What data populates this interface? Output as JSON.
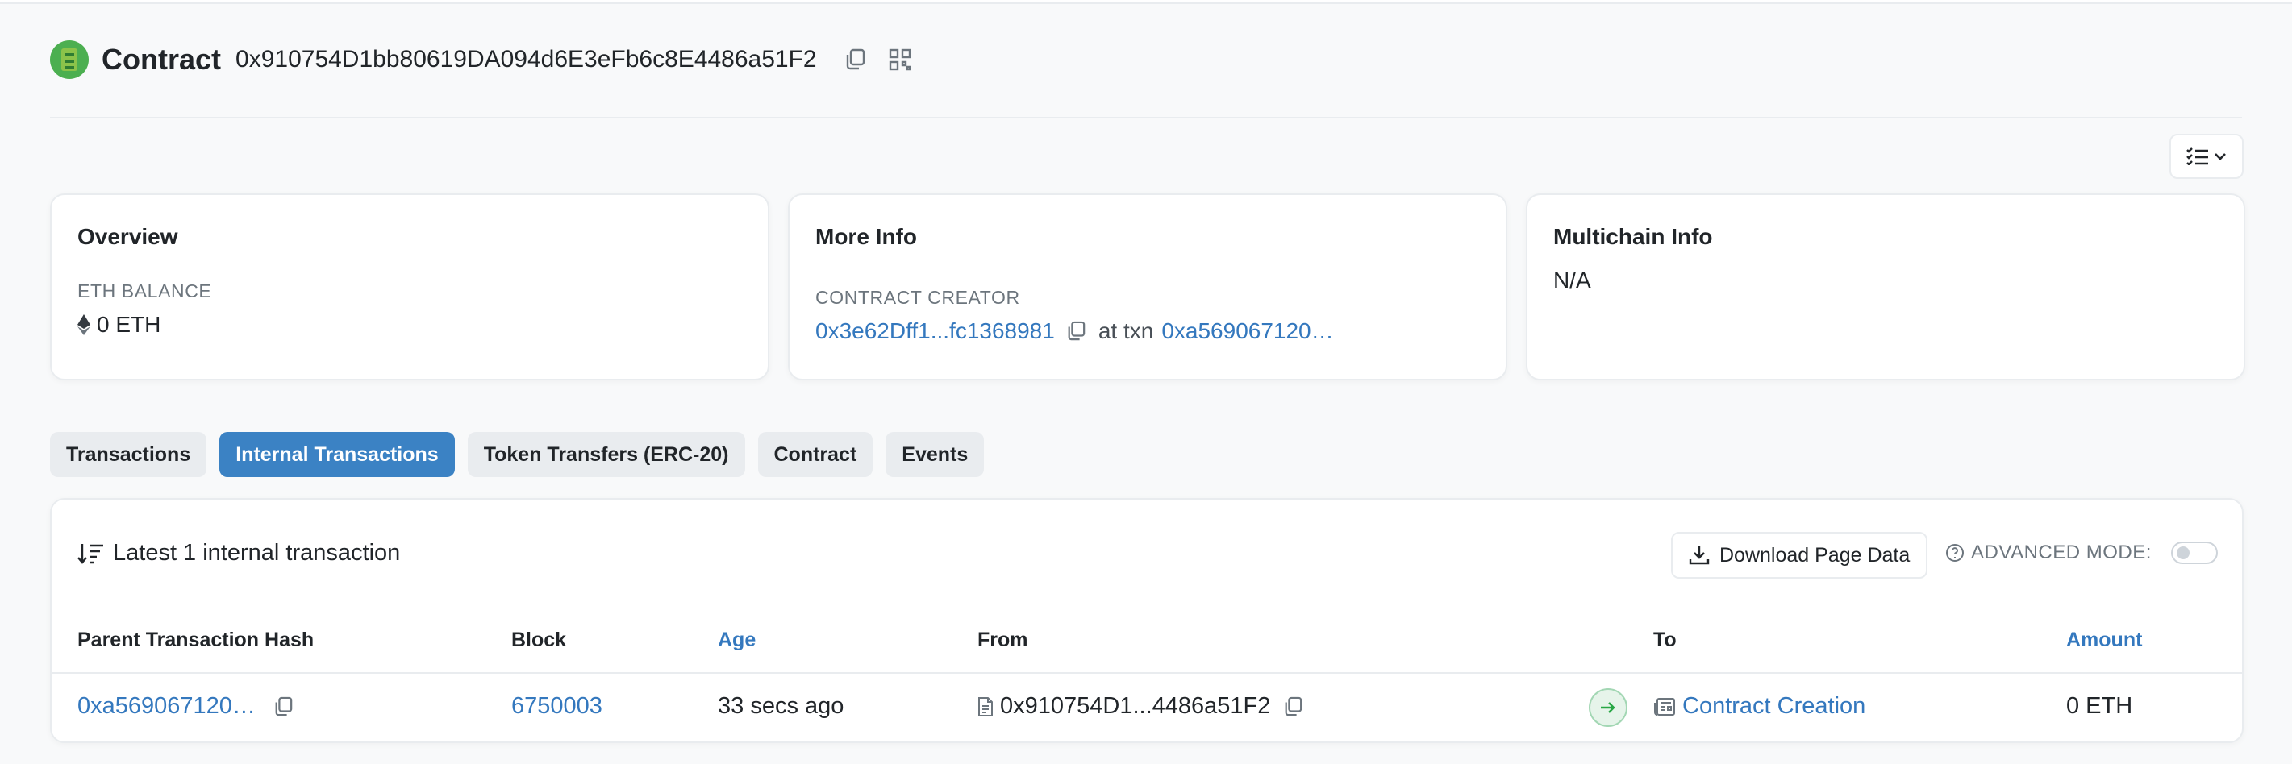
{
  "header": {
    "title": "Contract",
    "address": "0x910754D1bb80619DA094d6E3eFb6c8E4486a51F2",
    "icons": [
      "contract-logo-icon",
      "copy-icon",
      "qr-code-icon"
    ]
  },
  "view_toggle": {
    "icons": [
      "list-check-icon",
      "chevron-down-icon"
    ]
  },
  "overview": {
    "title": "Overview",
    "balance_label": "ETH BALANCE",
    "balance_value": "0 ETH",
    "balance_icon": "ethereum-icon"
  },
  "more_info": {
    "title": "More Info",
    "creator_label": "CONTRACT CREATOR",
    "creator_address": "0x3e62Dff1...fc1368981",
    "at_txn_label": "at txn",
    "txn_hash": "0xa569067120…"
  },
  "multichain": {
    "title": "Multichain Info",
    "value": "N/A"
  },
  "tabs": [
    {
      "label": "Transactions",
      "active": false
    },
    {
      "label": "Internal Transactions",
      "active": true
    },
    {
      "label": "Token Transfers (ERC-20)",
      "active": false
    },
    {
      "label": "Contract",
      "active": false
    },
    {
      "label": "Events",
      "active": false
    }
  ],
  "internal_txns": {
    "summary": "Latest 1 internal transaction",
    "download_label": "Download Page Data",
    "advanced_mode_label": "ADVANCED MODE:",
    "advanced_mode_on": false,
    "columns": [
      "Parent Transaction Hash",
      "Block",
      "Age",
      "From",
      "To",
      "Amount"
    ],
    "sortable_columns": [
      "Age",
      "Amount"
    ],
    "rows": [
      {
        "parent_hash": "0xa569067120…",
        "block": "6750003",
        "age": "33 secs ago",
        "from": "0x910754D1...4486a51F2",
        "to": "Contract Creation",
        "amount": "0 ETH"
      }
    ]
  },
  "colors": {
    "link": "#3478be",
    "active_tab": "#3b82c4",
    "page_bg": "#f8f9fa",
    "arrow_bg": "#e6f4ea"
  }
}
